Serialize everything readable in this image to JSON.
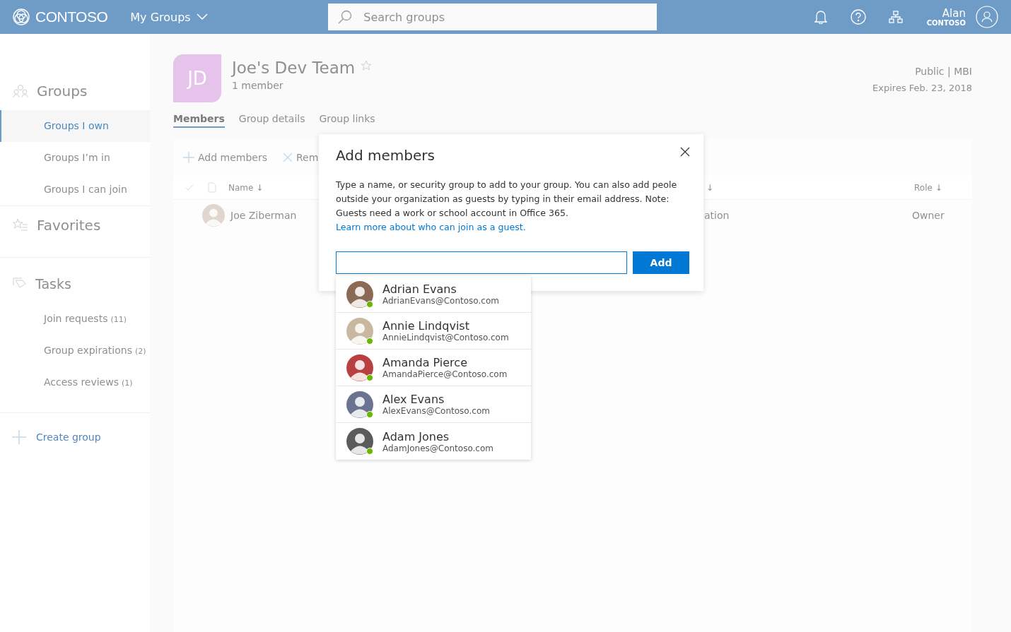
{
  "header": {
    "logo": "CONTOSO",
    "app_menu": "My Groups",
    "search": {
      "placeholder": "Search groups"
    },
    "user": {
      "name": "Alan",
      "org": "CONTOSO"
    }
  },
  "sidebar": {
    "sections": [
      {
        "kind": "groups",
        "title": "Groups",
        "items": [
          {
            "label": "Groups I own",
            "selected": true
          },
          {
            "label": "Groups I’m in",
            "selected": false
          },
          {
            "label": "Groups I can join",
            "selected": false
          }
        ]
      },
      {
        "kind": "favorites",
        "title": "Favorites"
      },
      {
        "kind": "tasks",
        "title": "Tasks",
        "items": [
          {
            "label": "Join requests",
            "count": "(11)",
            "selected": false
          },
          {
            "label": "Group expirations",
            "count": "(2)",
            "selected": false
          },
          {
            "label": "Access reviews",
            "count": "(1)",
            "selected": false
          }
        ]
      }
    ],
    "create": "Create group"
  },
  "group": {
    "initials": "JD",
    "name": "Joe's Dev Team",
    "favorite": false,
    "members": "1 member",
    "classification": "Public | MBI",
    "expires": "Expires Feb. 23, 2018"
  },
  "tabs": [
    {
      "label": "Members",
      "selected": true
    },
    {
      "label": "Group details",
      "selected": false
    },
    {
      "label": "Group links",
      "selected": false
    }
  ],
  "toolbar": {
    "add": "Add members",
    "remove": "Rem"
  },
  "table": {
    "columns": [
      {
        "label": "Name ↓"
      },
      {
        "label": "↓"
      },
      {
        "label": "Role ↓"
      }
    ],
    "rows": [
      {
        "name": "Joe Ziberman",
        "column_2": "ation",
        "role": "Owner"
      }
    ]
  },
  "dialog": {
    "title": "Add members",
    "text": "Type a name, or security group to add to your group. You can also add peole outside your organization as guests by typing in their email address. Note: Guests need a work or school account in Office 365.",
    "link": "Learn more about who can join as a guest.",
    "button": "Add",
    "suggestions": [
      {
        "name": "Adrian Evans",
        "email": "AdrianEvans@Contoso.com",
        "online": true
      },
      {
        "name": "Annie Lindqvist",
        "email": "AnnieLindqvist@Contoso.com",
        "online": true
      },
      {
        "name": "Amanda Pierce",
        "email": "AmandaPierce@Contoso.com",
        "online": true
      },
      {
        "name": "Alex Evans",
        "email": "AlexEvans@Contoso.com",
        "online": true
      },
      {
        "name": "Adam Jones",
        "email": "AdamJones@Contoso.com",
        "online": true
      }
    ]
  }
}
